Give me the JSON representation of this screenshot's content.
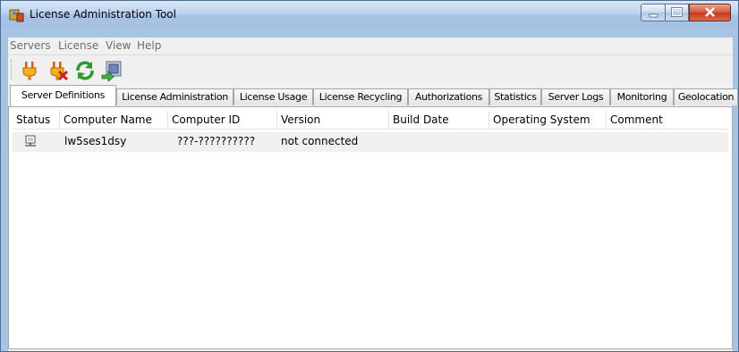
{
  "window": {
    "title": "License Administration Tool"
  },
  "menu": [
    "Servers",
    "License",
    "View",
    "Help"
  ],
  "toolbar": [
    {
      "icon": "plug-connect-icon"
    },
    {
      "icon": "plug-disconnect-icon"
    },
    {
      "icon": "refresh-icon"
    },
    {
      "icon": "export-icon"
    }
  ],
  "tabs": [
    "Server Definitions",
    "License Administration",
    "License Usage",
    "License Recycling",
    "Authorizations",
    "Statistics",
    "Server Logs",
    "Monitoring",
    "Geolocation"
  ],
  "active_tab": "Server Definitions",
  "table": {
    "columns": [
      "Status",
      "Computer Name",
      "Computer ID",
      "Version",
      "Build Date",
      "Operating System",
      "Comment"
    ],
    "rows": [
      {
        "status_icon": "computer-icon",
        "computer_name": "lw5ses1dsy",
        "computer_id": "???-??????????",
        "version": "not connected",
        "build_date": "",
        "operating_system": "",
        "comment": ""
      }
    ]
  }
}
